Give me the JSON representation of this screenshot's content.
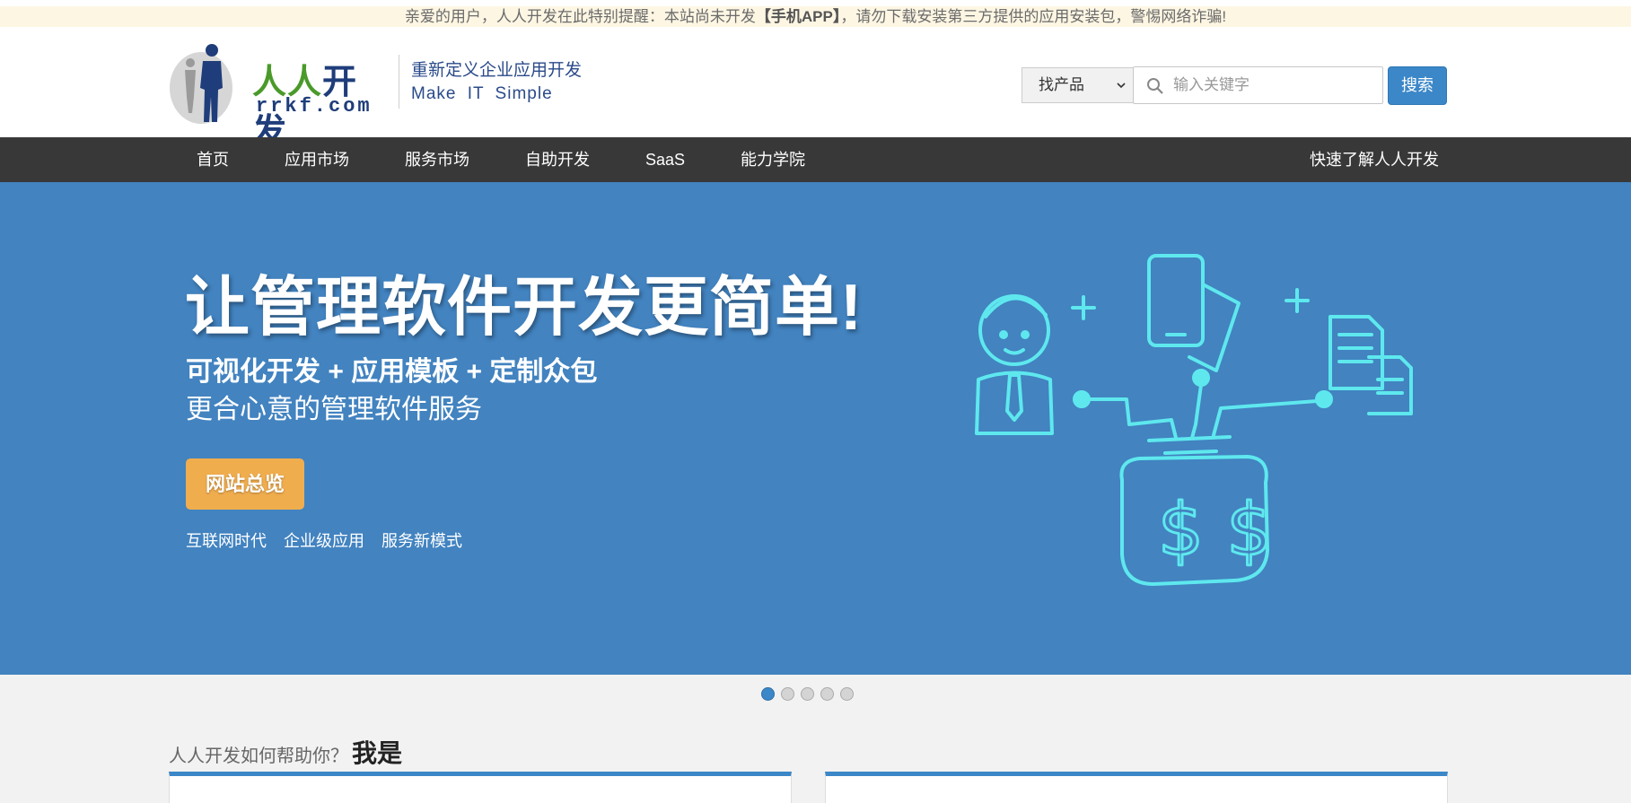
{
  "notice": {
    "before": "亲爱的用户，人人开发在此特别提醒：本站尚未开发",
    "highlight": "【手机APP】",
    "after": "，请勿下载安装第三方提供的应用安装包，警惕网络诈骗!"
  },
  "header": {
    "logo_cn_green": "人人",
    "logo_cn_blue": "开发",
    "logo_en": "rrkf.com",
    "slogan_line1": "重新定义企业应用开发",
    "slogan_line2": "Make IT Simple",
    "category_select": "找产品",
    "search_placeholder": "输入关键字",
    "search_button": "搜索"
  },
  "nav": {
    "items": [
      "首页",
      "应用市场",
      "服务市场",
      "自助开发",
      "SaaS",
      "能力学院"
    ],
    "right_link": "快速了解人人开发"
  },
  "hero": {
    "title": "让管理软件开发更简单!",
    "subtitle_bold": "可视化开发 + 应用模板 + 定制众包",
    "subtitle": "更合心意的管理软件服务",
    "button": "网站总览",
    "tags": [
      "互联网时代",
      "企业级应用",
      "服务新模式"
    ],
    "art_text": "$ $"
  },
  "carousel": {
    "slides": 5,
    "active_index": 0
  },
  "section": {
    "title_small": "人人开发如何帮助你？",
    "title_big": "我是"
  },
  "colors": {
    "hero_bg": "#4283c0",
    "nav_bg": "#383838",
    "accent_blue": "#3b87c8",
    "button_orange": "#f0ad4e",
    "notice_bg": "#fdf6e3",
    "art_cyan": "#5ee8ee"
  }
}
